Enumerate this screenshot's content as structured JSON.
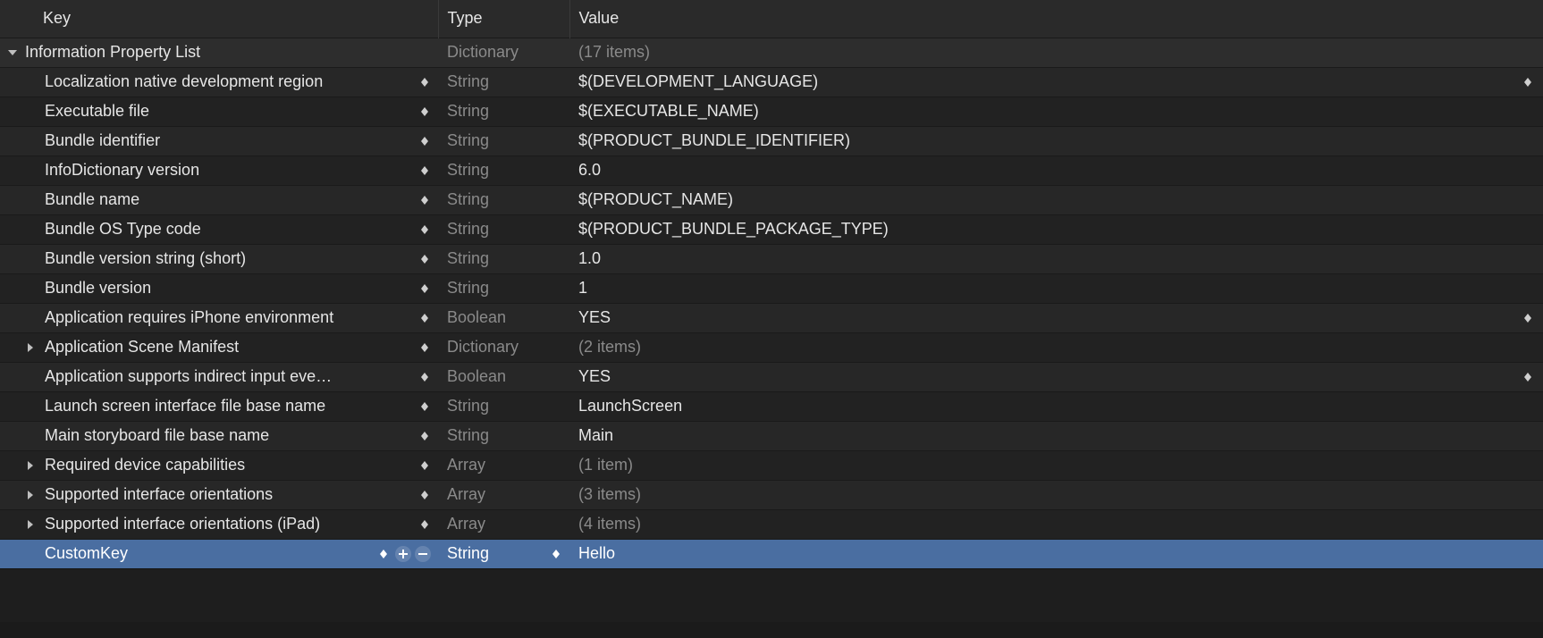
{
  "headers": {
    "key": "Key",
    "type": "Type",
    "value": "Value"
  },
  "root": {
    "key": "Information Property List",
    "type": "Dictionary",
    "value": "(17 items)"
  },
  "rows": [
    {
      "key": "Localization native development region",
      "type": "String",
      "value": "$(DEVELOPMENT_LANGUAGE)",
      "valueStepper": true
    },
    {
      "key": "Executable file",
      "type": "String",
      "value": "$(EXECUTABLE_NAME)"
    },
    {
      "key": "Bundle identifier",
      "type": "String",
      "value": "$(PRODUCT_BUNDLE_IDENTIFIER)"
    },
    {
      "key": "InfoDictionary version",
      "type": "String",
      "value": "6.0"
    },
    {
      "key": "Bundle name",
      "type": "String",
      "value": "$(PRODUCT_NAME)"
    },
    {
      "key": "Bundle OS Type code",
      "type": "String",
      "value": "$(PRODUCT_BUNDLE_PACKAGE_TYPE)"
    },
    {
      "key": "Bundle version string (short)",
      "type": "String",
      "value": "1.0"
    },
    {
      "key": "Bundle version",
      "type": "String",
      "value": "1"
    },
    {
      "key": "Application requires iPhone environment",
      "type": "Boolean",
      "value": "YES",
      "valueStepper": true
    },
    {
      "key": "Application Scene Manifest",
      "type": "Dictionary",
      "value": "(2 items)",
      "disclosure": "right",
      "dim": true
    },
    {
      "key": "Application supports indirect input eve…",
      "type": "Boolean",
      "value": "YES",
      "valueStepper": true
    },
    {
      "key": "Launch screen interface file base name",
      "type": "String",
      "value": "LaunchScreen"
    },
    {
      "key": "Main storyboard file base name",
      "type": "String",
      "value": "Main"
    },
    {
      "key": "Required device capabilities",
      "type": "Array",
      "value": "(1 item)",
      "disclosure": "right",
      "dim": true
    },
    {
      "key": "Supported interface orientations",
      "type": "Array",
      "value": "(3 items)",
      "disclosure": "right",
      "dim": true
    },
    {
      "key": "Supported interface orientations (iPad)",
      "type": "Array",
      "value": "(4 items)",
      "disclosure": "right",
      "dim": true
    },
    {
      "key": "CustomKey",
      "type": "String",
      "value": "Hello",
      "selected": true,
      "plusminus": true,
      "typeStepper": true
    }
  ]
}
